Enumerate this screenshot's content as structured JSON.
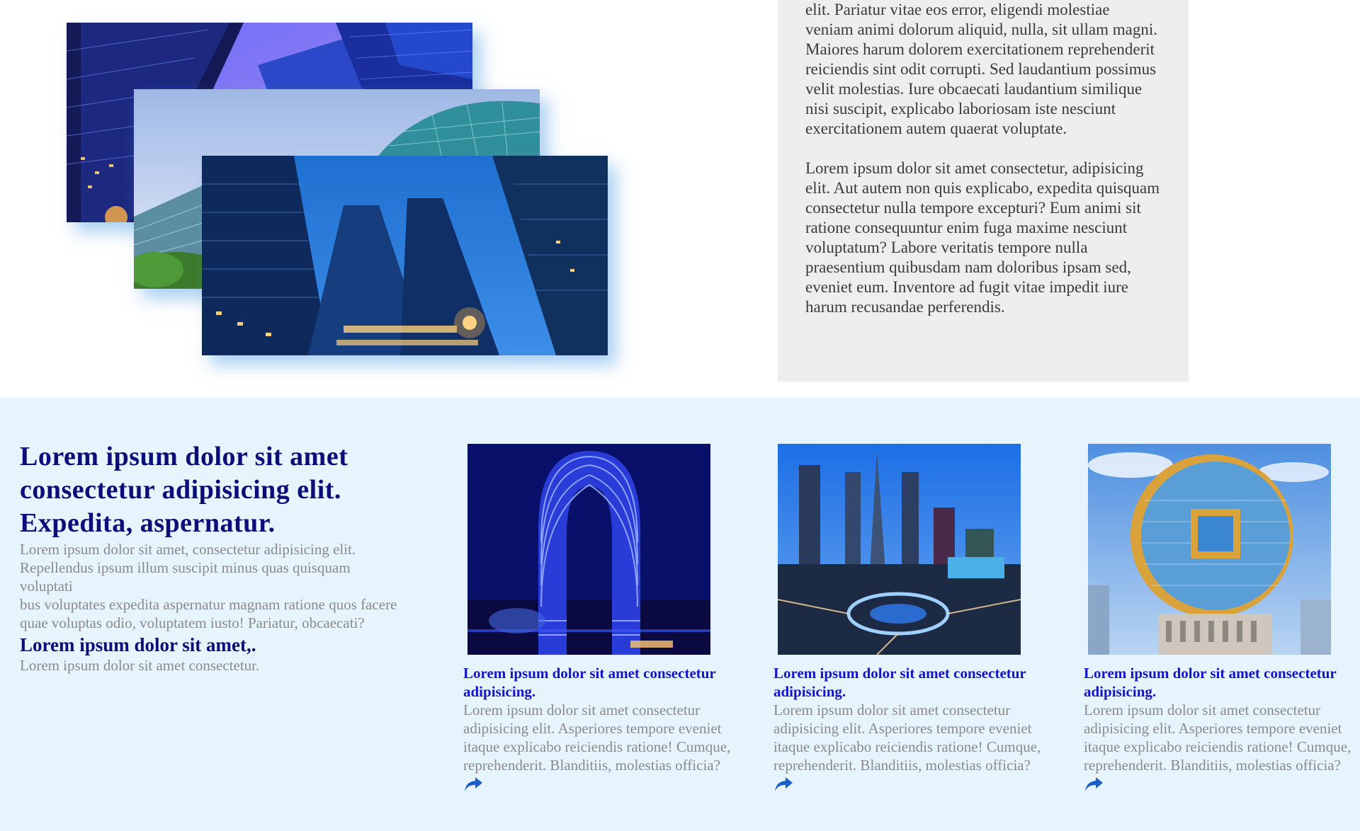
{
  "gallery": {
    "photos": [
      {
        "alt": "glass skyscrapers from below"
      },
      {
        "alt": "curved glass office building"
      },
      {
        "alt": "tall towers at dusk"
      }
    ]
  },
  "article": {
    "paragraphs": [
      "Lorem ipsum dolor sit, amet consectetur adipisicing elit. Pariatur vitae eos error, eligendi molestiae veniam animi dolorum aliquid, nulla, sit ullam magni. Maiores harum dolorem exercitationem reprehenderit reiciendis sint odit corrupti. Sed laudantium possimus velit molestias. Iure obcaecati laudantium similique nisi suscipit, explicabo laboriosam iste nesciunt exercitationem autem quaerat voluptate.",
      "Lorem ipsum dolor sit amet consectetur, adipisicing elit. Aut autem non quis explicabo, expedita quisquam consectetur nulla tempore excepturi? Eum animi sit ratione consequuntur enim fuga maxime nesciunt voluptatum? Labore veritatis tempore nulla praesentium quibusdam nam doloribus ipsam sed, eveniet eum. Inventore ad fugit vitae impedit iure harum recusandae perferendis."
    ]
  },
  "intro": {
    "heading": "Lorem ipsum dolor sit amet consectetur adipisicing elit. Expedita, aspernatur.",
    "text_line1": "Lorem ipsum dolor sit amet, consectetur adipisicing elit. Repellendus ipsum illum suscipit minus quas quisquam voluptati",
    "text_line2": "bus voluptates expedita aspernatur magnam ratione quos facere quae voluptas odio, voluptatem iusto! Pariatur, obcaecati?",
    "subheading": "Lorem ipsum dolor sit amet,.",
    "subtext": "Lorem ipsum dolor sit amet consectetur."
  },
  "cards": [
    {
      "image": "blue lit horseshoe hotel at night",
      "title": "Lorem ipsum dolor sit amet consectetur adipisicing.",
      "text": "Lorem ipsum dolor sit amet consectetur adipisicing elit. Asperiores tempore eveniet itaque explicabo reiciendis ratione! Cumque, reprehenderit. Blanditiis, molestias officia?",
      "icon": "share-icon"
    },
    {
      "image": "city skyline with roundabout at dusk",
      "title": "Lorem ipsum dolor sit amet consectetur adipisicing.",
      "text": "Lorem ipsum dolor sit amet consectetur adipisicing elit. Asperiores tempore eveniet itaque explicabo reiciendis ratione! Cumque, reprehenderit. Blanditiis, molestias officia?",
      "icon": "share-icon"
    },
    {
      "image": "circular coin-shaped building",
      "title": "Lorem ipsum dolor sit amet consectetur adipisicing.",
      "text": "Lorem ipsum dolor sit amet consectetur adipisicing elit. Asperiores tempore eveniet itaque explicabo reiciendis ratione! Cumque, reprehenderit. Blanditiis, molestias officia?",
      "icon": "share-icon"
    }
  ],
  "colors": {
    "heading": "#0d0d7a",
    "card_title": "#1414c8",
    "muted_text": "#8a8a8a",
    "bottom_bg": "#e6f4fd",
    "panel_bg": "#eeeeee",
    "icon": "#1a5fc8"
  }
}
